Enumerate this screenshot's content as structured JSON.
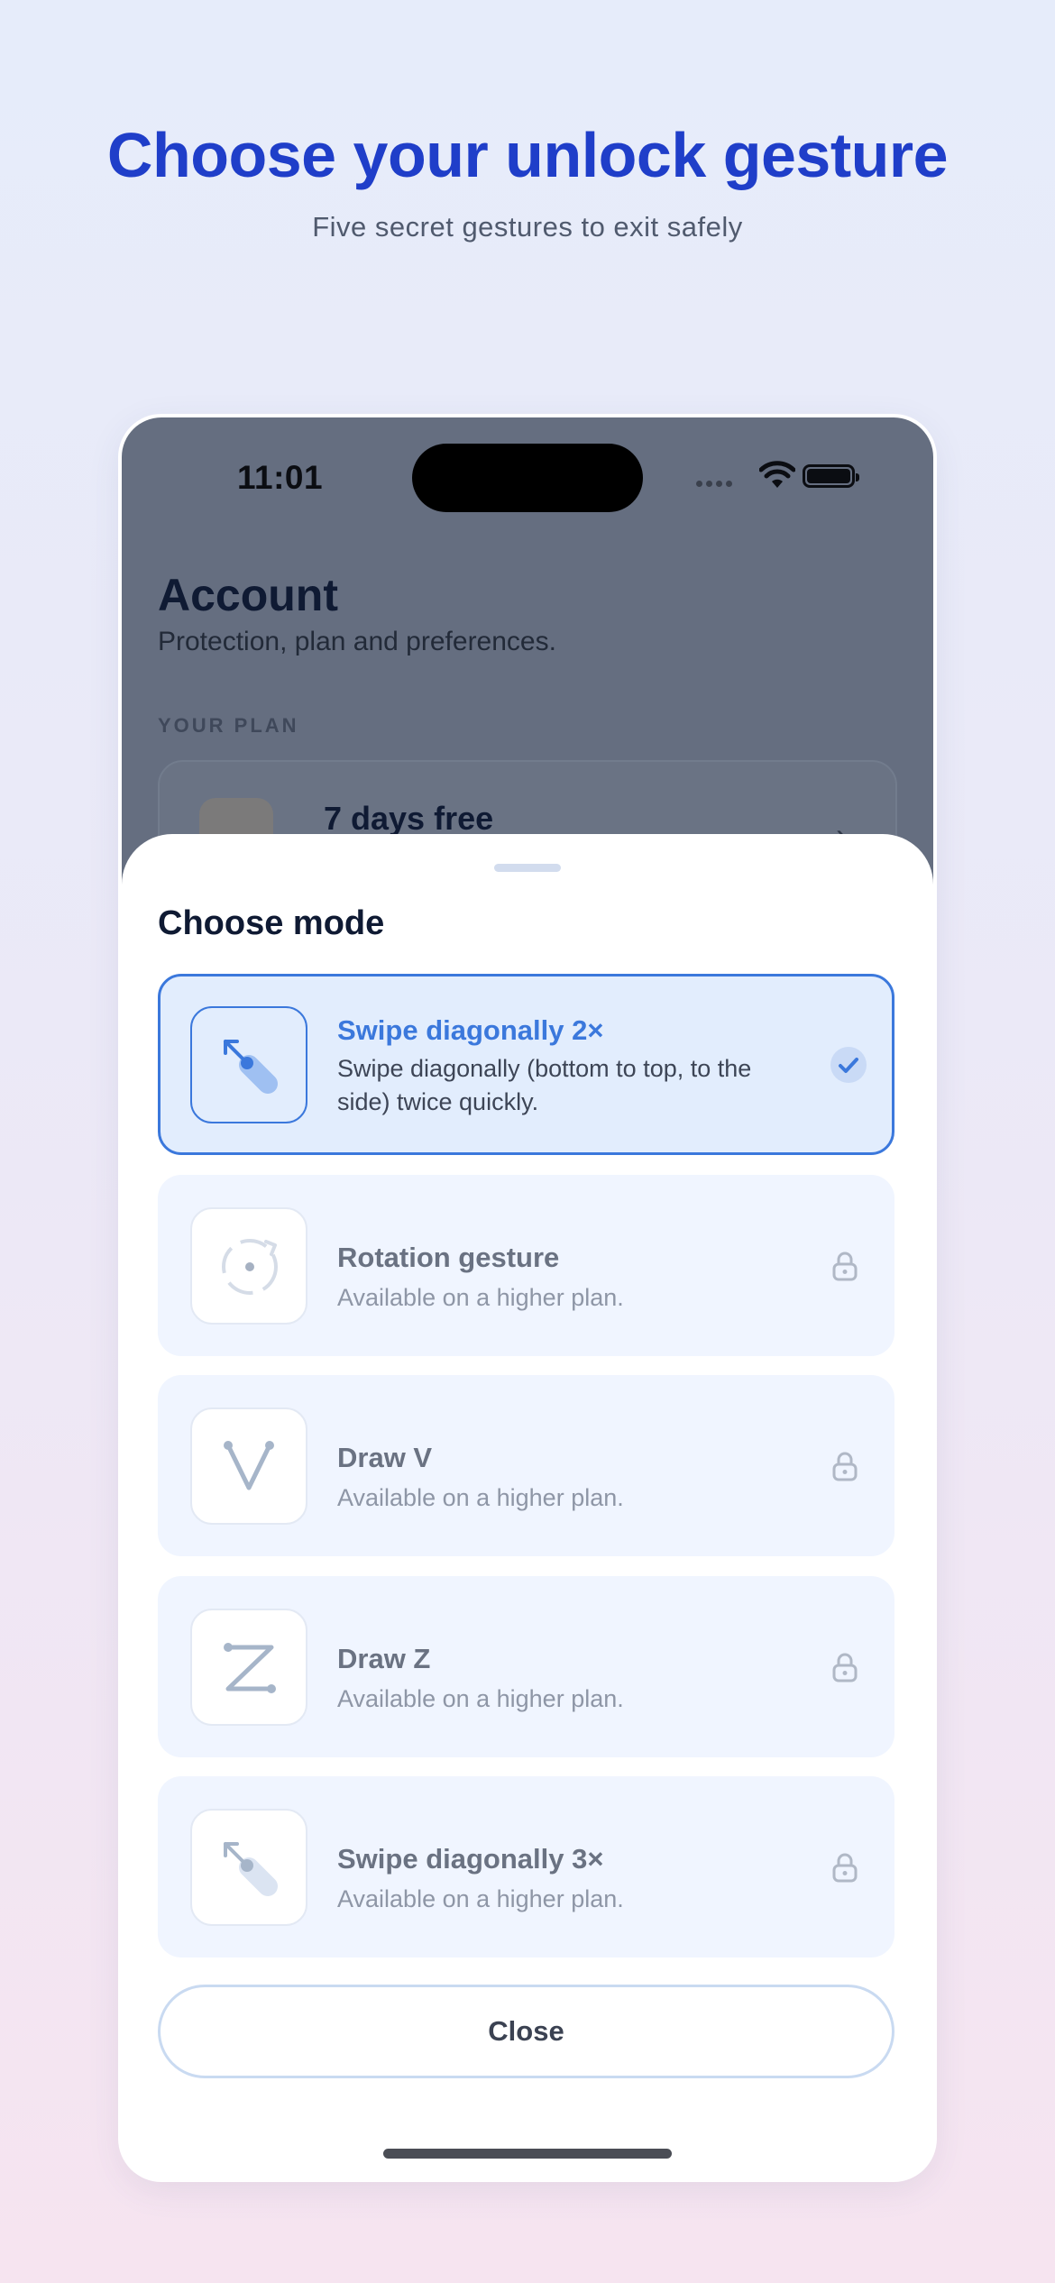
{
  "promo": {
    "headline": "Choose your unlock gesture",
    "subheadline": "Five secret gestures to exit safely"
  },
  "status_bar": {
    "time": "11:01"
  },
  "background_screen": {
    "title": "Account",
    "subtitle": "Protection, plan and preferences.",
    "plan_section_label": "YOUR PLAN",
    "plan_card_title": "7 days free",
    "plan_card_chevron": "›"
  },
  "sheet": {
    "title": "Choose mode",
    "options": [
      {
        "name": "Swipe diagonally 2×",
        "description": "Swipe diagonally (bottom to top, to the side) twice quickly.",
        "icon": "swipe-diagonal-icon",
        "state": "selected"
      },
      {
        "name": "Rotation gesture",
        "description": "Available on a higher plan.",
        "icon": "rotation-icon",
        "state": "locked"
      },
      {
        "name": "Draw V",
        "description": "Available on a higher plan.",
        "icon": "draw-v-icon",
        "state": "locked"
      },
      {
        "name": "Draw Z",
        "description": "Available on a higher plan.",
        "icon": "draw-z-icon",
        "state": "locked"
      },
      {
        "name": "Swipe diagonally 3×",
        "description": "Available on a higher plan.",
        "icon": "swipe-diagonal-icon",
        "state": "locked"
      }
    ],
    "close_label": "Close"
  },
  "colors": {
    "accent": "#3b78dc",
    "headline": "#1f3ec9",
    "locked_text": "#6a7282",
    "option_background": "#f0f5ff"
  }
}
